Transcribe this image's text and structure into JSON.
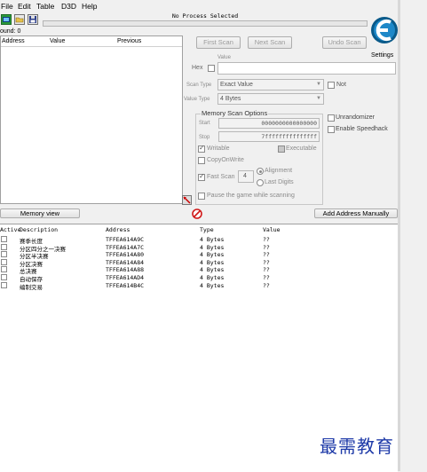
{
  "menu": [
    "File",
    "Edit",
    "Table",
    "D3D",
    "Help"
  ],
  "process_label": "No Process Selected",
  "found_label": "ound: 0",
  "results_headers": [
    "Address",
    "Value",
    "Previous"
  ],
  "buttons": {
    "first_scan": "First Scan",
    "next_scan": "Next Scan",
    "undo_scan": "Undo Scan",
    "memory_view": "Memory view",
    "add_address": "Add Address Manually"
  },
  "settings_label": "Settings",
  "value_label": "Value",
  "hex_label": "Hex",
  "scan_type_label": "Scan Type",
  "scan_type_value": "Exact Value",
  "value_type_label": "Value Type",
  "value_type_value": "4 Bytes",
  "not_label": "Not",
  "mem_opts_title": "Memory Scan Options",
  "start_label": "Start",
  "start_value": "0000000000000000",
  "stop_label": "Stop",
  "stop_value": "7fffffffffffffff",
  "writable_label": "Writable",
  "executable_label": "Executable",
  "copyonwrite_label": "CopyOnWrite",
  "fastscan_label": "Fast Scan",
  "fastscan_value": "4",
  "alignment_label": "Alignment",
  "lastdigits_label": "Last Digits",
  "pause_label": "Pause the game while scanning",
  "unrandomizer_label": "Unrandomizer",
  "speedhack_label": "Enable Speedhack",
  "table_headers": [
    "Active",
    "Description",
    "Address",
    "Type",
    "Value"
  ],
  "entries": [
    {
      "desc": "赛季长度",
      "addr": "TFFEA614A9C",
      "type": "4 Bytes",
      "value": "??"
    },
    {
      "desc": "分区四分之一决赛",
      "addr": "TFFEA614A7C",
      "type": "4 Bytes",
      "value": "??"
    },
    {
      "desc": "分区半决赛",
      "addr": "TFFEA614A80",
      "type": "4 Bytes",
      "value": "??"
    },
    {
      "desc": "分区决赛",
      "addr": "TFFEA614A84",
      "type": "4 Bytes",
      "value": "??"
    },
    {
      "desc": "总决赛",
      "addr": "TFFEA614A88",
      "type": "4 Bytes",
      "value": "??"
    },
    {
      "desc": "自动保存",
      "addr": "TFFEA614AD4",
      "type": "4 Bytes",
      "value": "??"
    },
    {
      "desc": "编制交易",
      "addr": "TFFEA614B4C",
      "type": "4 Bytes",
      "value": "??"
    }
  ],
  "watermark": "最需教育"
}
